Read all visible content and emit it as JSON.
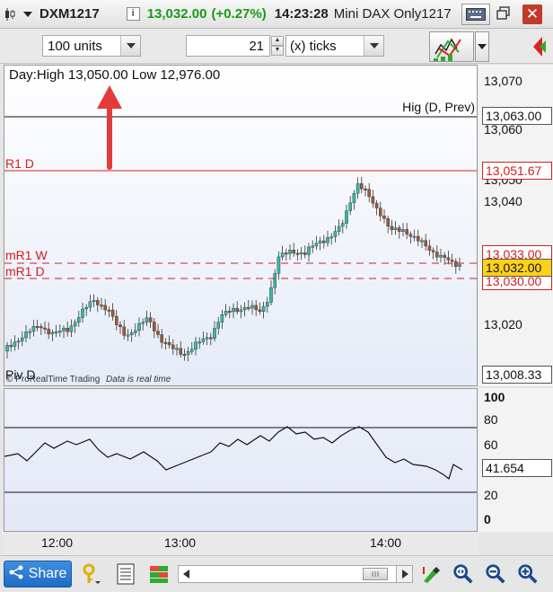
{
  "title_bar": {
    "symbol": "DXM1217",
    "price": "13,032.00",
    "change": "(+0.27%)",
    "time": "14:23:28",
    "instrument": "Mini DAX Only1217",
    "info_icon_glyph": "i"
  },
  "toolbar": {
    "units_value": "100 units",
    "ticks_value": "21",
    "ticks_mode": "(x) ticks"
  },
  "main_chart": {
    "info_text": "Day:High 13,050.00 Low 12,976.00",
    "watermark": "© ProRealTime Trading",
    "realtime_text": "Data is real time",
    "hig_label": "Hig (D, Prev)",
    "r1_label": "R1 D",
    "mr1w_label": "mR1 W",
    "mr1d_label": "mR1 D",
    "piv_label": "Piv D",
    "tags": {
      "hig": "13,063.00",
      "r1": "13,051.67",
      "mr1w": "13,033.00",
      "current": "13,032.00",
      "mr1d": "13,030.00",
      "piv": "13,008.33"
    },
    "axis_ticks": [
      "13,070",
      "13,060",
      "13,050",
      "13,040",
      "13,020"
    ]
  },
  "oscillator": {
    "current_value": "41.654",
    "axis_ticks": [
      "100",
      "80",
      "60",
      "20",
      "0"
    ],
    "levels": [
      75,
      25
    ]
  },
  "time_axis": {
    "labels": [
      "12:00",
      "13:00",
      "14:00"
    ]
  },
  "bottom_bar": {
    "share_label": "Share"
  },
  "colors": {
    "up_candle": "#36b7a7",
    "down_candle": "#a0573a",
    "r1_line": "#d02020",
    "pivot_dash": "#d02020",
    "arrow": "#e33b3b",
    "price_change": "#1a9a1a",
    "current_tag": "#ffd21a"
  }
}
